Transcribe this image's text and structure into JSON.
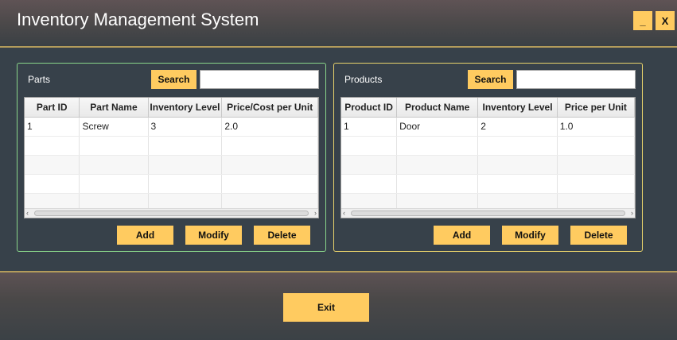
{
  "app": {
    "title": "Inventory Management System",
    "minimize_label": "_",
    "close_label": "X"
  },
  "parts": {
    "title": "Parts",
    "search_label": "Search",
    "search_value": "",
    "columns": [
      "Part ID",
      "Part Name",
      "Inventory Level",
      "Price/Cost per Unit"
    ],
    "rows": [
      [
        "1",
        "Screw",
        "3",
        "2.0"
      ]
    ],
    "add_label": "Add",
    "modify_label": "Modify",
    "delete_label": "Delete"
  },
  "products": {
    "title": "Products",
    "search_label": "Search",
    "search_value": "",
    "columns": [
      "Product ID",
      "Product Name",
      "Inventory Level",
      "Price per Unit"
    ],
    "rows": [
      [
        "1",
        "Door",
        "2",
        "1.0"
      ]
    ],
    "add_label": "Add",
    "modify_label": "Modify",
    "delete_label": "Delete"
  },
  "footer": {
    "exit_label": "Exit"
  },
  "colors": {
    "background": "#37414a",
    "accent_button": "#ffcb60",
    "parts_border": "#89d58a",
    "products_border": "#e8d26b",
    "divider": "#b39c5b"
  }
}
